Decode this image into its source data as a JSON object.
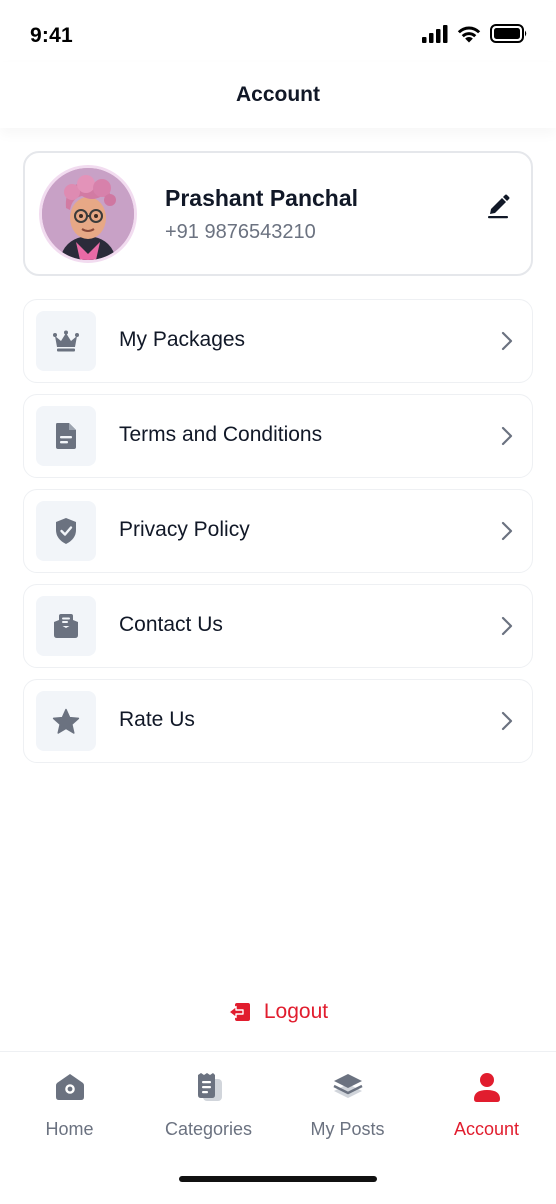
{
  "status_bar": {
    "time": "9:41",
    "icons": [
      "signal-icon",
      "wifi-icon",
      "battery-icon"
    ]
  },
  "header": {
    "title": "Account"
  },
  "profile": {
    "name": "Prashant Panchal",
    "phone": "+91 9876543210",
    "edit_icon": "pencil-icon"
  },
  "menu": [
    {
      "label": "My Packages",
      "icon": "crown-icon"
    },
    {
      "label": "Terms and Conditions",
      "icon": "document-icon"
    },
    {
      "label": "Privacy Policy",
      "icon": "shield-check-icon"
    },
    {
      "label": "Contact Us",
      "icon": "mail-inbox-icon"
    },
    {
      "label": "Rate Us",
      "icon": "star-icon"
    }
  ],
  "logout": {
    "label": "Logout",
    "icon": "logout-icon"
  },
  "bottom_nav": [
    {
      "label": "Home",
      "icon": "home-icon",
      "active": false
    },
    {
      "label": "Categories",
      "icon": "categories-icon",
      "active": false
    },
    {
      "label": "My Posts",
      "icon": "layers-icon",
      "active": false
    },
    {
      "label": "Account",
      "icon": "user-icon",
      "active": true
    }
  ],
  "colors": {
    "accent": "#e11d2e",
    "text_primary": "#111827",
    "text_secondary": "#6b7280",
    "icon_gray": "#6b7280",
    "icon_bg": "#f2f5f9"
  }
}
